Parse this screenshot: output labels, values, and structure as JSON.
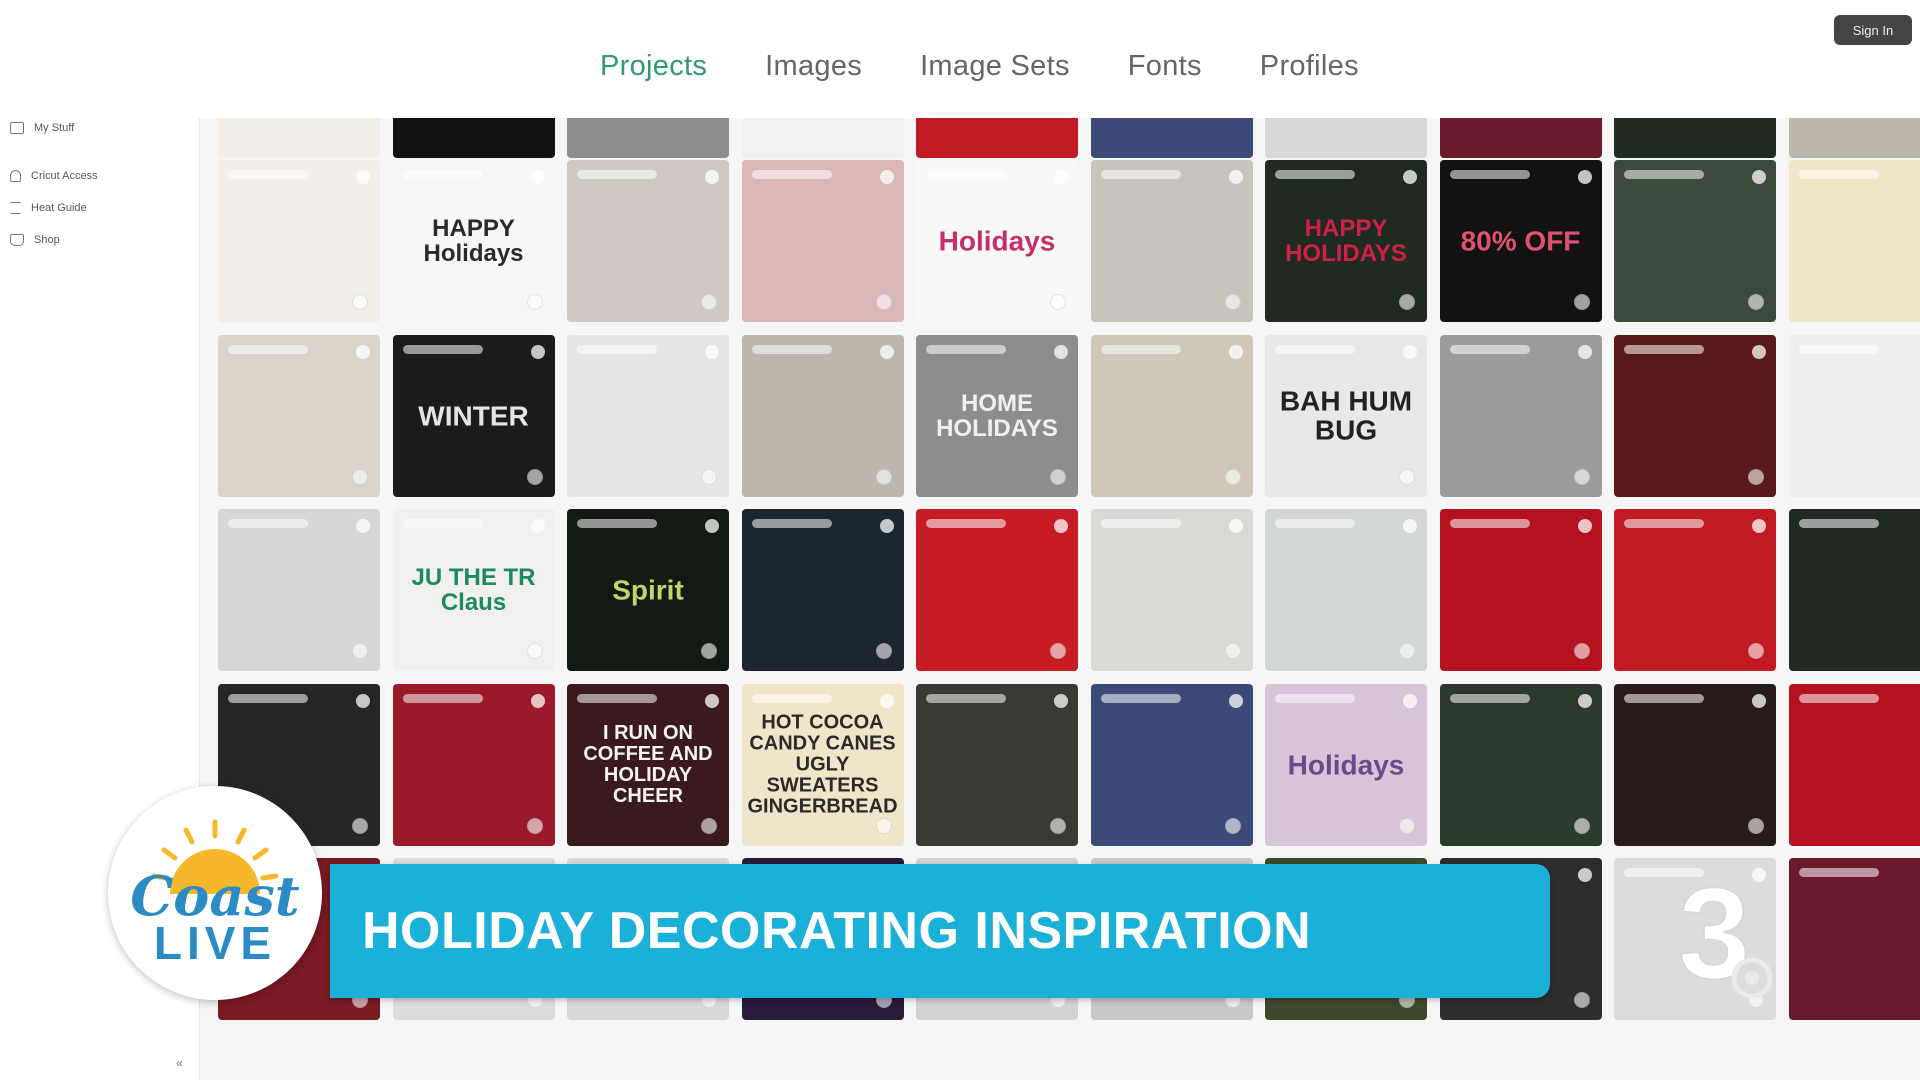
{
  "header": {
    "tabs": [
      {
        "label": "Projects",
        "active": true
      },
      {
        "label": "Images",
        "active": false
      },
      {
        "label": "Image Sets",
        "active": false
      },
      {
        "label": "Fonts",
        "active": false
      },
      {
        "label": "Profiles",
        "active": false
      }
    ],
    "sign_in": "Sign In"
  },
  "sidebar": {
    "items": [
      {
        "label": "My Stuff",
        "icon": "folder-icon"
      },
      {
        "label": "Cricut Access",
        "icon": "lock-icon"
      },
      {
        "label": "Heat Guide",
        "icon": "list-icon"
      },
      {
        "label": "Shop",
        "icon": "bag-icon"
      }
    ],
    "collapse": "«"
  },
  "tiles": [
    {
      "bg": "#f3efe8",
      "fg": "#c0202a",
      "text": ""
    },
    {
      "bg": "#f6f6f4",
      "fg": "#2a2a2a",
      "text": "HAPPY Holidays"
    },
    {
      "bg": "#cfc9c2",
      "fg": "#3a3a3a",
      "text": ""
    },
    {
      "bg": "#d9b7b7",
      "fg": "#7a1a22",
      "text": ""
    },
    {
      "bg": "#f8f8f6",
      "fg": "#c2306a",
      "text": "Holidays"
    },
    {
      "bg": "#c9c4bb",
      "fg": "#8a1a1a",
      "text": ""
    },
    {
      "bg": "#1f2b1f",
      "fg": "#d0204a",
      "text": "HAPPY HOLIDAYS"
    },
    {
      "bg": "#121212",
      "fg": "#e0536e",
      "text": "80% OFF"
    },
    {
      "bg": "#3b4a3a",
      "fg": "#d8a2b0",
      "text": ""
    },
    {
      "bg": "#efe6c8",
      "fg": "#4a6e9a",
      "text": ""
    },
    {
      "bg": "#d9d3c9",
      "fg": "#555",
      "text": ""
    },
    {
      "bg": "#1b1b1b",
      "fg": "#e4e4e4",
      "text": "WINTER"
    },
    {
      "bg": "#e6e6e6",
      "fg": "#555",
      "text": ""
    },
    {
      "bg": "#bdb6ad",
      "fg": "#7a1a22",
      "text": ""
    },
    {
      "bg": "#8d8d8d",
      "fg": "#f0f0f0",
      "text": "HOME HOLIDAYS"
    },
    {
      "bg": "#cfc8b8",
      "fg": "#4d6e2a",
      "text": ""
    },
    {
      "bg": "#e8e8e6",
      "fg": "#222",
      "text": "BAH HUM BUG"
    },
    {
      "bg": "#9c9c9c",
      "fg": "#444",
      "text": ""
    },
    {
      "bg": "#5a1a1a",
      "fg": "#f4f4f4",
      "text": ""
    },
    {
      "bg": "#efefef",
      "fg": "#c0202a",
      "text": ""
    },
    {
      "bg": "#d6d6d4",
      "fg": "#b01e2a",
      "text": ""
    },
    {
      "bg": "#f0f0ee",
      "fg": "#1c8a5a",
      "text": "JU THE TR Claus"
    },
    {
      "bg": "#131a13",
      "fg": "#b8d86a",
      "text": "Spirit"
    },
    {
      "bg": "#1c2630",
      "fg": "#e4e4e4",
      "text": ""
    },
    {
      "bg": "#c81c24",
      "fg": "#ffffff",
      "text": ""
    },
    {
      "bg": "#d9d9d6",
      "fg": "#777",
      "text": ""
    },
    {
      "bg": "#d3d7d3",
      "fg": "#2c8a5a",
      "text": ""
    },
    {
      "bg": "#b3121e",
      "fg": "#2fa07a",
      "text": ""
    },
    {
      "bg": "#c21a22",
      "fg": "#f2e6d8",
      "text": ""
    },
    {
      "bg": "#1f2a22",
      "fg": "#e8e8e8",
      "text": ""
    },
    {
      "bg": "#262626",
      "fg": "#cfcfcf",
      "text": ""
    },
    {
      "bg": "#9a1a2a",
      "fg": "#3aa06a",
      "text": ""
    },
    {
      "bg": "#3a1a1e",
      "fg": "#f4f4f4",
      "text": "I RUN ON COFFEE AND HOLIDAY CHEER"
    },
    {
      "bg": "#efe6c9",
      "fg": "#2a2a2a",
      "text": "HOT COCOA CANDY CANES UGLY SWEATERS GINGERBREAD"
    },
    {
      "bg": "#3a3a33",
      "fg": "#e8e8e8",
      "text": ""
    },
    {
      "bg": "#3c4a7a",
      "fg": "#f08a3a",
      "text": ""
    },
    {
      "bg": "#d7c4d8",
      "fg": "#6a4a8a",
      "text": "Holidays"
    },
    {
      "bg": "#2b3a2b",
      "fg": "#e8e8e8",
      "text": ""
    },
    {
      "bg": "#2a1b1b",
      "fg": "#e8e8e8",
      "text": ""
    },
    {
      "bg": "#b4121e",
      "fg": "#f2e0e0",
      "text": ""
    },
    {
      "bg": "#7a1a22",
      "fg": "#eee",
      "text": ""
    },
    {
      "bg": "#dcdcdc",
      "fg": "#555",
      "text": ""
    },
    {
      "bg": "#d8d8d8",
      "fg": "#555",
      "text": ""
    },
    {
      "bg": "#2a1a3a",
      "fg": "#eee",
      "text": ""
    },
    {
      "bg": "#d3d3d3",
      "fg": "#555",
      "text": ""
    },
    {
      "bg": "#c8c8c6",
      "fg": "#555",
      "text": ""
    },
    {
      "bg": "#3a4a2a",
      "fg": "#eee",
      "text": ""
    },
    {
      "bg": "#2d2d2d",
      "fg": "#ddd",
      "text": ""
    },
    {
      "bg": "#dcdcdc",
      "fg": "#555",
      "text": ""
    },
    {
      "bg": "#6a1a2a",
      "fg": "#eee",
      "text": ""
    }
  ],
  "overlay": {
    "headline": "HOLIDAY DECORATING INSPIRATION",
    "logo_line1": "Coast",
    "logo_line2": "LIVE",
    "station": "3"
  },
  "colors": {
    "accent_green": "#2f9a6f",
    "banner_blue": "#1ab0d8",
    "logo_blue": "#2c8bc4",
    "sun_yellow": "#f5b82a"
  }
}
